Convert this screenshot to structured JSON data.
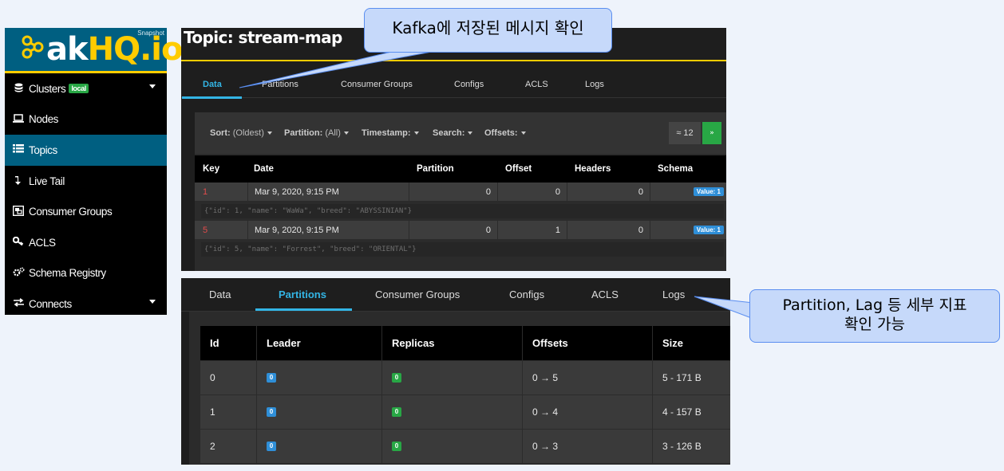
{
  "sidebar": {
    "logo_snapshot": "Snapshot",
    "logo_word_white": "ak",
    "logo_word_gold": "HQ.io",
    "items": [
      {
        "label": "Clusters",
        "icon": "database-icon",
        "badge": "local",
        "has_caret": true
      },
      {
        "label": "Nodes",
        "icon": "laptop-icon"
      },
      {
        "label": "Topics",
        "icon": "list-icon",
        "active": true
      },
      {
        "label": "Live Tail",
        "icon": "level-down-icon"
      },
      {
        "label": "Consumer Groups",
        "icon": "object-group-icon"
      },
      {
        "label": "ACLS",
        "icon": "key-icon"
      },
      {
        "label": "Schema Registry",
        "icon": "cogs-icon"
      },
      {
        "label": "Connects",
        "icon": "exchange-icon",
        "has_caret": true
      }
    ]
  },
  "top_panel": {
    "title": "Topic: stream-map",
    "tabs": [
      "Data",
      "Partitions",
      "Consumer Groups",
      "Configs",
      "ACLS",
      "Logs"
    ],
    "filters": {
      "sort_label": "Sort:",
      "sort_value": "(Oldest)",
      "partition_label": "Partition:",
      "partition_value": "(All)",
      "timestamp_label": "Timestamp:",
      "search_label": "Search:",
      "offsets_label": "Offsets:"
    },
    "pager_count": "≈ 12",
    "pager_next": "»",
    "columns": [
      "Key",
      "Date",
      "Partition",
      "Offset",
      "Headers",
      "Schema"
    ],
    "records": [
      {
        "key": "1",
        "date": "Mar 9, 2020, 9:15 PM",
        "partition": "0",
        "offset": "0",
        "headers": "0",
        "schema": "Value: 1",
        "json": "{\"id\": 1, \"name\": \"WaWa\", \"breed\": \"ABYSSINIAN\"}"
      },
      {
        "key": "5",
        "date": "Mar 9, 2020, 9:15 PM",
        "partition": "0",
        "offset": "1",
        "headers": "0",
        "schema": "Value: 1",
        "json": "{\"id\": 5, \"name\": \"Forrest\", \"breed\": \"ORIENTAL\"}"
      }
    ]
  },
  "bottom_panel": {
    "tabs": [
      "Data",
      "Partitions",
      "Consumer Groups",
      "Configs",
      "ACLS",
      "Logs"
    ],
    "columns": [
      "Id",
      "Leader",
      "Replicas",
      "Offsets",
      "Size"
    ],
    "rows": [
      {
        "id": "0",
        "leader": "0",
        "replicas": "0",
        "offsets": "0 → 5",
        "size": "5 - 171 B"
      },
      {
        "id": "1",
        "leader": "0",
        "replicas": "0",
        "offsets": "0 → 4",
        "size": "4 - 157 B"
      },
      {
        "id": "2",
        "leader": "0",
        "replicas": "0",
        "offsets": "0 → 3",
        "size": "3 - 126 B"
      }
    ]
  },
  "callouts": {
    "data_note": "Kafka에 저장된 메시지 확인",
    "partition_note_line1": "Partition, Lag 등 세부 지표",
    "partition_note_line2": "확인 가능"
  },
  "colors": {
    "brand_blue": "#005f81",
    "brand_gold": "#ffcc00",
    "tab_active": "#33b5e5",
    "badge_green": "#28a745",
    "badge_blue": "#2f8fd8",
    "callout_fill": "#c6d9fa",
    "callout_border": "#5a8ef0"
  }
}
